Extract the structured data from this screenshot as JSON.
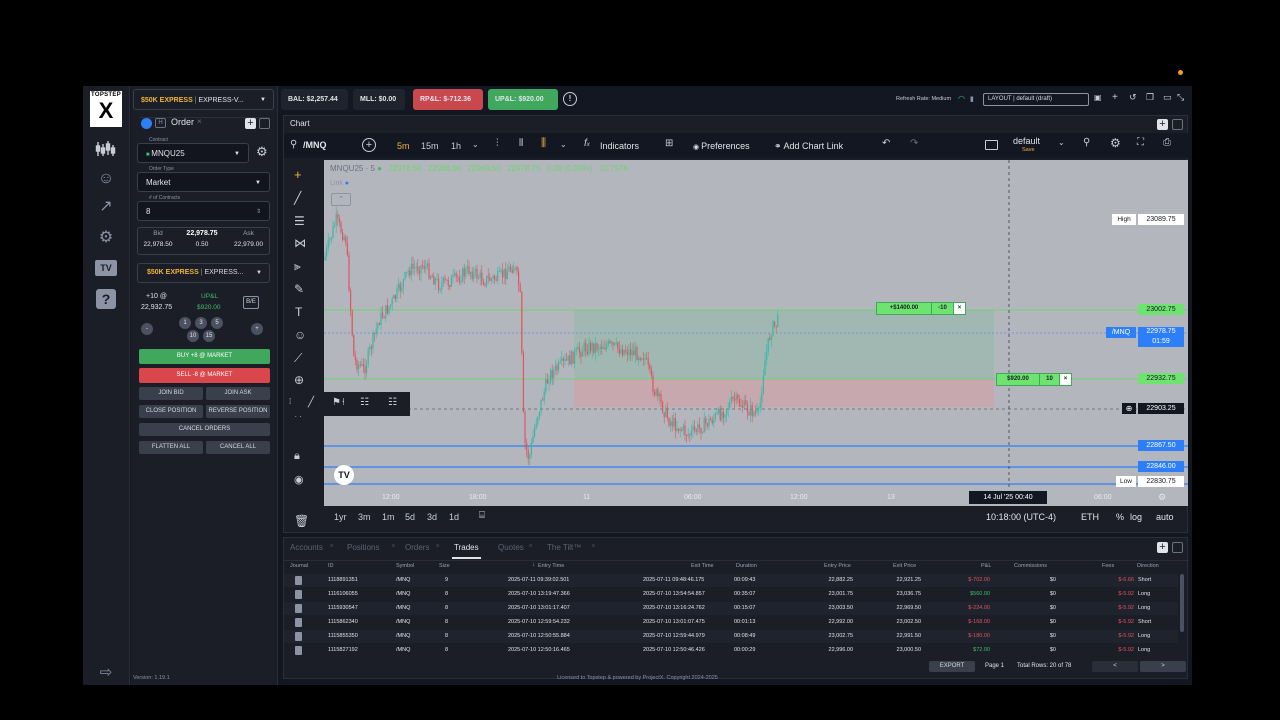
{
  "rail": {
    "logo_top": "TOPSTEP",
    "logo_bottom": "X"
  },
  "order": {
    "tab_label": "Order",
    "contract_label": "Contract",
    "contract_value": "MNQU25",
    "order_type_label": "Order Type",
    "order_type_value": "Market",
    "num_contracts_label": "# of Contracts",
    "num_contracts_value": "8",
    "bid_label": "Bid",
    "bid_value": "22,978.50",
    "last_value": "22,978.75",
    "spread_value": "0.50",
    "ask_label": "Ask",
    "ask_value": "22,979.00",
    "account_brand": "$50K EXPRESS",
    "account_name": "EXPRESS...",
    "position": "+10 @",
    "position_price": "22,932.75",
    "upl_label": "UP&L",
    "upl_value": "$920.00",
    "be_label": "B/E",
    "qty_minus": "-",
    "qty_plus": "+",
    "qty_values": [
      "1",
      "3",
      "5",
      "10",
      "15"
    ],
    "buy_label": "BUY +8 @ MARKET",
    "sell_label": "SELL -8 @ MARKET",
    "join_bid": "JOIN BID",
    "join_ask": "JOIN ASK",
    "close_position": "CLOSE POSITION",
    "reverse_position": "REVERSE POSITION",
    "cancel_orders": "CANCEL ORDERS",
    "flatten_all": "FLATTEN ALL",
    "cancel_all": "CANCEL ALL",
    "version": "Version: 1.19.1"
  },
  "topbar": {
    "account_brand": "$50K EXPRESS",
    "account_name": "EXPRESS-V...",
    "bal": "BAL: $2,257.44",
    "mll": "MLL: $0.00",
    "rpl": "RP&L: $-712.36",
    "upl": "UP&L: $920.00",
    "refresh": "Refresh Rate: Medium",
    "layout": "LAYOUT | default (draft)"
  },
  "chart": {
    "tab": "Chart",
    "symbol": "/MNQ",
    "intervals": [
      "5m",
      "15m",
      "1h"
    ],
    "indicators": "Indicators",
    "preferences": "Preferences",
    "add_chart_link": "Add Chart Link",
    "layout_name": "default",
    "layout_save": "Save",
    "legend_title": "MNQU25 · 5",
    "legend_o": "22978.50",
    "legend_h": "22988.00",
    "legend_l": "22969.50",
    "legend_c": "22978.75",
    "legend_chg": "0.00 (0.00%)",
    "legend_vol": "10.757K",
    "link_label": "Link",
    "tags": {
      "high_label": "High",
      "high": "23089.75",
      "tp": "23002.75",
      "sym_label": "/MNQ",
      "price": "22978.75",
      "countdown": "01:59",
      "entry": "22932.75",
      "cross": "22903.25",
      "l1": "22867.50",
      "l2": "22846.00",
      "low_label": "Low",
      "low": "22830.75"
    },
    "tp_order": "+$1400.00",
    "tp_qty": "-10",
    "pos_tag": "$920.00",
    "pos_qty": "10",
    "time_ticks": [
      "12:00",
      "18:00",
      "11",
      "06:00",
      "12:00",
      "13",
      "18:00",
      "06:00"
    ],
    "crosshair_time": "14 Jul '25   00:40",
    "ranges": [
      "1yr",
      "3m",
      "1m",
      "5d",
      "3d",
      "1d"
    ],
    "clock": "10:18:00 (UTC-4)",
    "session": "ETH",
    "pct": "%",
    "log": "log",
    "auto": "auto"
  },
  "trades": {
    "tabs": [
      "Accounts",
      "Positions",
      "Orders",
      "Trades",
      "Quotes",
      "The Tilt™"
    ],
    "headers": [
      "Journal",
      "ID",
      "Symbol",
      "Size",
      "Entry Time",
      "Exit Time",
      "Duration",
      "Entry Price",
      "Exit Price",
      "P&L",
      "Commissions",
      "Fees",
      "Direction"
    ],
    "rows": [
      [
        "1118891351",
        "/MNQ",
        "9",
        "2025-07-11 09:39:02.501",
        "2025-07-11 09:48:46.175",
        "00:09:43",
        "22,882.25",
        "22,921.25",
        "$-702.00",
        "$0",
        "$-6.66",
        "Short"
      ],
      [
        "1116106055",
        "/MNQ",
        "8",
        "2025-07-10 13:19:47.366",
        "2025-07-10 13:54:54.857",
        "00:35:07",
        "23,001.75",
        "23,036.75",
        "$560.00",
        "$0",
        "$-5.92",
        "Long"
      ],
      [
        "1115930547",
        "/MNQ",
        "8",
        "2025-07-10 13:01:17.407",
        "2025-07-10 13:16:24.762",
        "00:15:07",
        "23,003.50",
        "22,969.50",
        "$-224.00",
        "$0",
        "$-5.92",
        "Long"
      ],
      [
        "1115862340",
        "/MNQ",
        "8",
        "2025-07-10 12:59:54.232",
        "2025-07-10 13:01:07.475",
        "00:01:13",
        "22,992.00",
        "23,002.50",
        "$-168.00",
        "$0",
        "$-5.92",
        "Short"
      ],
      [
        "1115855350",
        "/MNQ",
        "8",
        "2025-07-10 12:50:55.884",
        "2025-07-10 12:59:44.979",
        "00:08:49",
        "23,002.75",
        "22,991.50",
        "$-180.00",
        "$0",
        "$-5.92",
        "Long"
      ],
      [
        "1115827192",
        "/MNQ",
        "8",
        "2025-07-10 12:50:16.465",
        "2025-07-10 12:50:46.426",
        "00:00:29",
        "22,996.00",
        "23,000.50",
        "$72.00",
        "$0",
        "$-5.92",
        "Long"
      ]
    ],
    "export": "EXPORT",
    "page": "Page 1",
    "total": "Total Rows: 20 of 78",
    "prev": "<",
    "next": ">"
  },
  "footer": "Licensed to Topstep & powered by ProjectX. Copyright 2024-2025"
}
